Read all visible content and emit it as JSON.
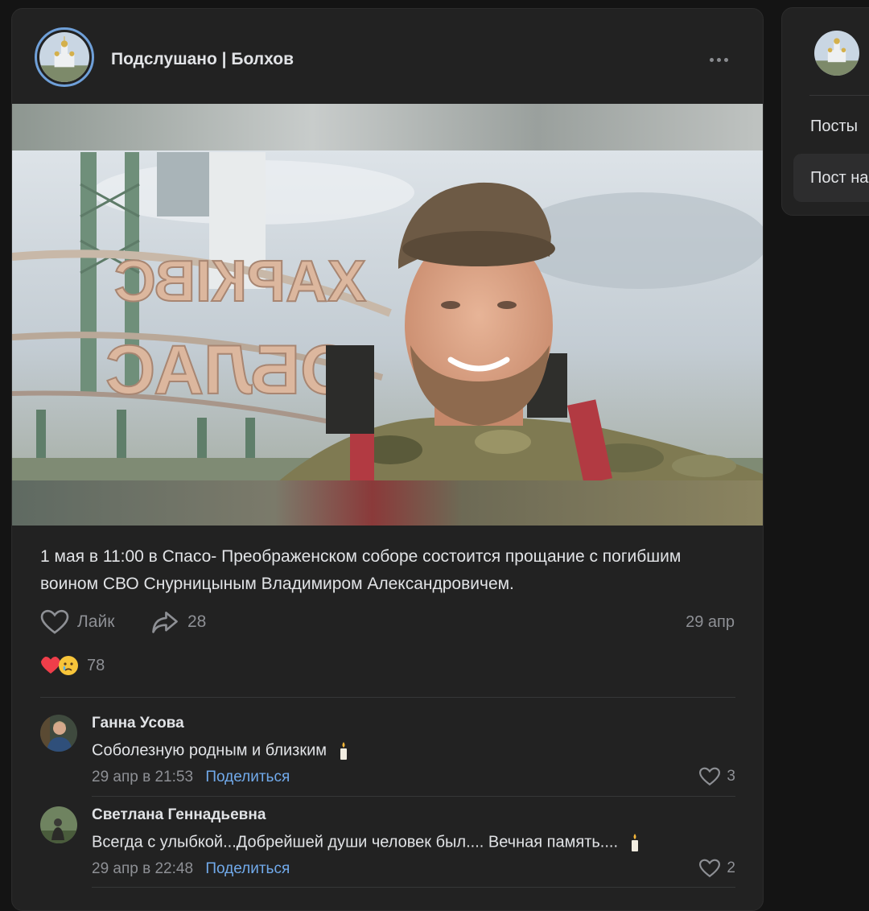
{
  "post": {
    "group_name": "Подслушано | Болхов",
    "text": "1 мая в 11:00 в Спасо- Преображенском соборе состоится прощание с погибшим воином СВО Снурницыным Владимиром Александровичем.",
    "like_label": "Лайк",
    "share_count": "28",
    "date": "29 апр",
    "reactions_count": "78"
  },
  "photo_sign": {
    "line1": "ХАРКІВС",
    "line2": "ОБЛАС"
  },
  "comments": [
    {
      "author": "Ганна Усова",
      "text": "Соболезную родным и близким",
      "date": "29 апр в 21:53",
      "share_label": "Поделиться",
      "likes": "3"
    },
    {
      "author": "Светлана Геннадьевна",
      "text": "Всегда с улыбкой...Добрейшей души человек был.... Вечная память....",
      "date": "29 апр в 22:48",
      "share_label": "Поделиться",
      "likes": "2"
    }
  ],
  "sidebar": {
    "item1": "Посты",
    "item2": "Пост на"
  },
  "colors": {
    "background": "#141414",
    "card": "#222222",
    "text": "#e1e3e6",
    "secondary": "#8e9095",
    "link": "#71aaeb",
    "avatar_ring": "#6fa0d9"
  },
  "icons": [
    "more-icon",
    "heart-icon",
    "share-arrow-icon",
    "heart-reaction-emoji",
    "crying-reaction-emoji",
    "candle-icon"
  ]
}
